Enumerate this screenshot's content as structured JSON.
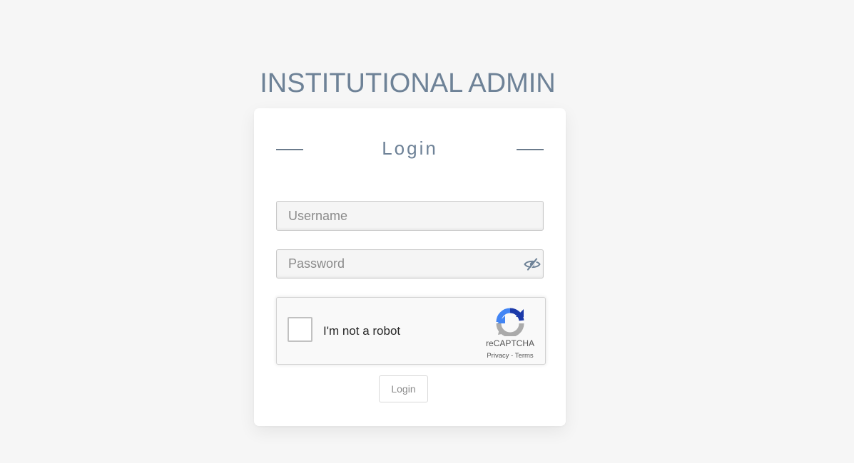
{
  "app": {
    "title": "INSTITUTIONAL ADMIN"
  },
  "login_card": {
    "heading": "Login",
    "username": {
      "placeholder": "Username",
      "value": ""
    },
    "password": {
      "placeholder": "Password",
      "value": "",
      "toggle_icon": "eye-slash-icon"
    },
    "recaptcha": {
      "label": "I'm not a robot",
      "brand": "reCAPTCHA",
      "privacy": "Privacy",
      "separator": "-",
      "terms": "Terms",
      "checked": false
    },
    "submit_label": "Login"
  },
  "colors": {
    "title": "#6e8297",
    "background": "#f6f6f6",
    "card": "#ffffff"
  }
}
